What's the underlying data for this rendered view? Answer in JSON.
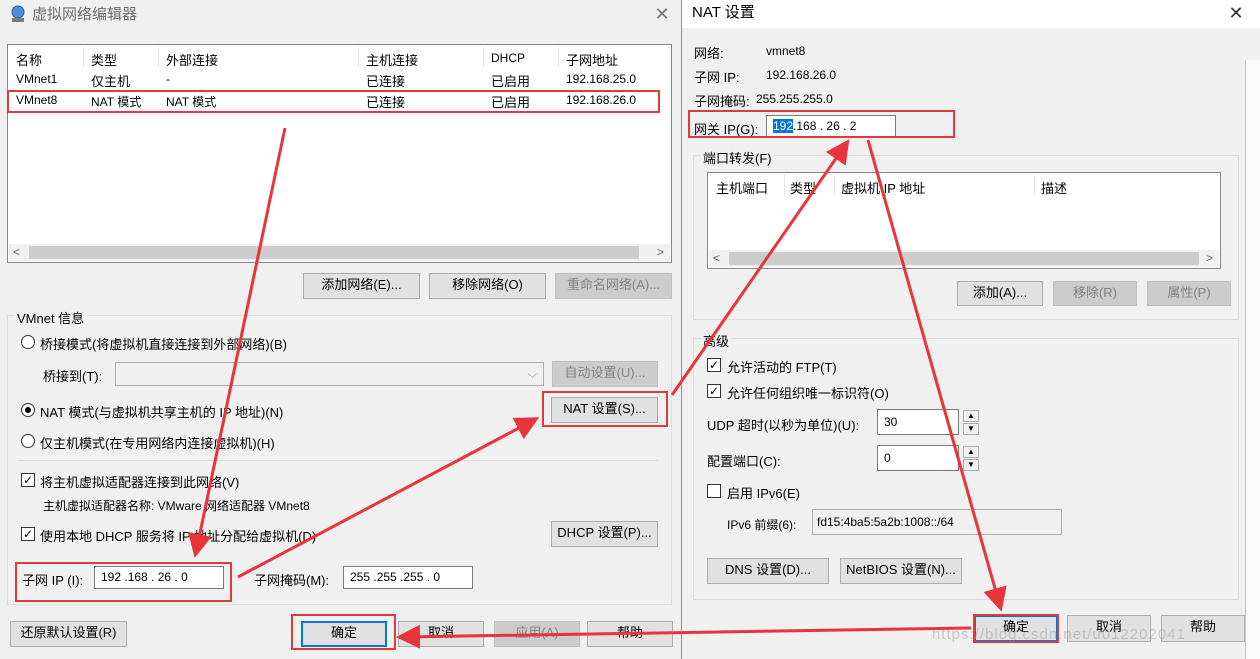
{
  "left": {
    "title": "虚拟网络编辑器",
    "table": {
      "headers": [
        "名称",
        "类型",
        "外部连接",
        "主机连接",
        "DHCP",
        "子网地址"
      ],
      "rows": [
        [
          "VMnet1",
          "仅主机",
          "-",
          "已连接",
          "已启用",
          "192.168.25.0"
        ],
        [
          "VMnet8",
          "NAT 模式",
          "NAT 模式",
          "已连接",
          "已启用",
          "192.168.26.0"
        ]
      ]
    },
    "add_network": "添加网络(E)...",
    "remove_network": "移除网络(O)",
    "rename_network": "重命名网络(A)...",
    "vmnet_info": "VMnet 信息",
    "bridge_mode": "桥接模式(将虚拟机直接连接到外部网络)(B)",
    "bridge_to": "桥接到(T):",
    "auto_settings": "自动设置(U)...",
    "nat_mode": "NAT 模式(与虚拟机共享主机的 IP 地址)(N)",
    "nat_settings": "NAT 设置(S)...",
    "host_only": "仅主机模式(在专用网络内连接虚拟机)(H)",
    "connect_adapter": "将主机虚拟适配器连接到此网络(V)",
    "adapter_name": "主机虚拟适配器名称: VMware 网络适配器 VMnet8",
    "use_dhcp": "使用本地 DHCP 服务将 IP 地址分配给虚拟机(D)",
    "dhcp_settings": "DHCP 设置(P)...",
    "subnet_ip_label": "子网 IP (I):",
    "subnet_ip": "192 .168 . 26 .  0",
    "subnet_mask_label": "子网掩码(M):",
    "subnet_mask": "255 .255 .255 .  0",
    "restore_defaults": "还原默认设置(R)",
    "ok": "确定",
    "cancel": "取消",
    "apply": "应用(A)",
    "help": "帮助"
  },
  "right": {
    "title": "NAT 设置",
    "network_label": "网络:",
    "network_value": "vmnet8",
    "subnet_ip_label": "子网 IP:",
    "subnet_ip_value": "192.168.26.0",
    "subnet_mask_label": "子网掩码:",
    "subnet_mask_value": "255.255.255.0",
    "gateway_label": "网关 IP(G):",
    "gateway_sel": "192",
    "gateway_rest": ".168 . 26  .  2",
    "port_forward": "端口转发(F)",
    "pf_headers": [
      "主机端口",
      "类型",
      "虚拟机 IP 地址",
      "描述"
    ],
    "add": "添加(A)...",
    "remove": "移除(R)",
    "properties": "属性(P)",
    "advanced": "高级",
    "allow_ftp": "允许活动的 FTP(T)",
    "allow_oui": "允许任何组织唯一标识符(O)",
    "udp_label": "UDP 超时(以秒为单位)(U):",
    "udp_value": "30",
    "config_port_label": "配置端口(C):",
    "config_port_value": "0",
    "enable_ipv6": "启用 IPv6(E)",
    "ipv6_prefix_label": "IPv6 前缀(6):",
    "ipv6_prefix_value": "fd15:4ba5:5a2b:1008::/64",
    "dns": "DNS 设置(D)...",
    "netbios": "NetBIOS 设置(N)...",
    "ok": "确定",
    "cancel": "取消",
    "help": "帮助",
    "watermark": "https://blog.csdn.net/u012202041"
  }
}
